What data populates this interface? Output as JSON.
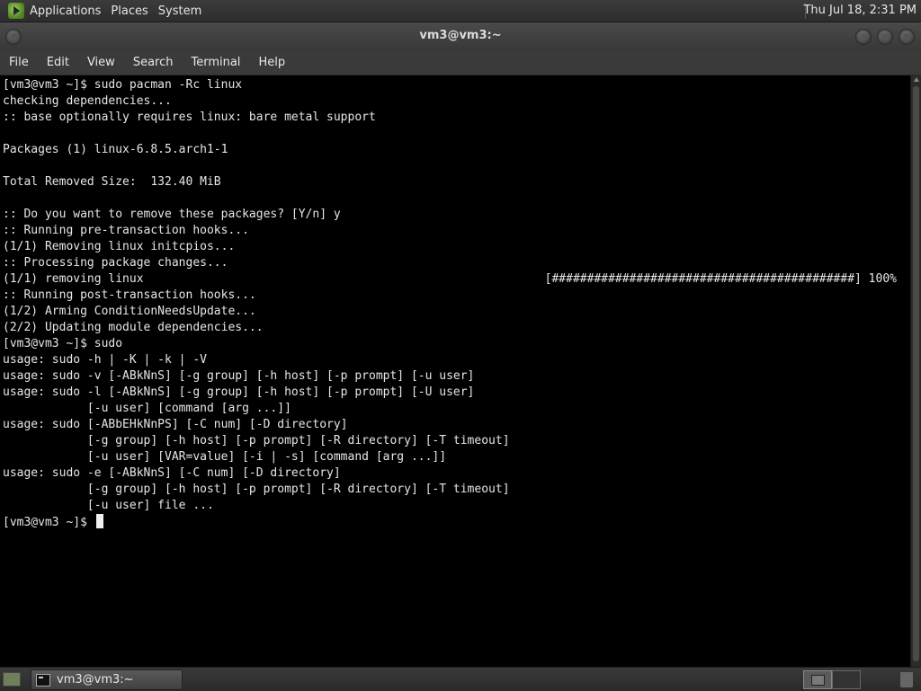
{
  "top_panel": {
    "menus": [
      "Applications",
      "Places",
      "System"
    ],
    "clock": "Thu Jul 18,  2:31 PM"
  },
  "window": {
    "title": "vm3@vm3:~"
  },
  "menubar": {
    "items": [
      "File",
      "Edit",
      "View",
      "Search",
      "Terminal",
      "Help"
    ]
  },
  "terminal": {
    "lines": [
      "[vm3@vm3 ~]$ sudo pacman -Rc linux",
      "checking dependencies...",
      ":: base optionally requires linux: bare metal support",
      "",
      "Packages (1) linux-6.8.5.arch1-1",
      "",
      "Total Removed Size:  132.40 MiB",
      "",
      ":: Do you want to remove these packages? [Y/n] y",
      ":: Running pre-transaction hooks...",
      "(1/1) Removing linux initcpios...",
      ":: Processing package changes...",
      "(1/1) removing linux                                                         [###########################################] 100%",
      ":: Running post-transaction hooks...",
      "(1/2) Arming ConditionNeedsUpdate...",
      "(2/2) Updating module dependencies...",
      "[vm3@vm3 ~]$ sudo",
      "usage: sudo -h | -K | -k | -V",
      "usage: sudo -v [-ABkNnS] [-g group] [-h host] [-p prompt] [-u user]",
      "usage: sudo -l [-ABkNnS] [-g group] [-h host] [-p prompt] [-U user]",
      "            [-u user] [command [arg ...]]",
      "usage: sudo [-ABbEHkNnPS] [-C num] [-D directory]",
      "            [-g group] [-h host] [-p prompt] [-R directory] [-T timeout]",
      "            [-u user] [VAR=value] [-i | -s] [command [arg ...]]",
      "usage: sudo -e [-ABkNnS] [-C num] [-D directory]",
      "            [-g group] [-h host] [-p prompt] [-R directory] [-T timeout]",
      "            [-u user] file ..."
    ],
    "prompt": "[vm3@vm3 ~]$ "
  },
  "taskbar": {
    "task_label": "vm3@vm3:~"
  },
  "colors": {
    "terminal_bg": "#000000",
    "terminal_fg": "#e6e6e6",
    "panel_bg": "#2c2c2c"
  }
}
